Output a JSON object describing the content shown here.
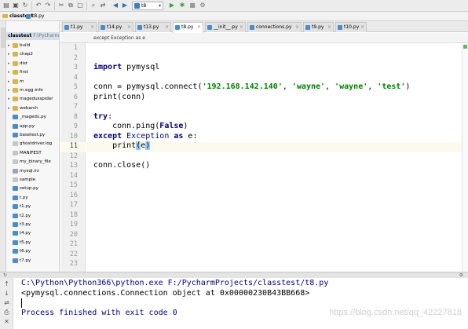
{
  "toolbar": {
    "run_config": "t8",
    "icons": [
      "folder-open-icon",
      "save-icon",
      "sync-icon",
      "undo-icon",
      "redo-icon",
      "cut-icon",
      "copy-icon",
      "paste-icon",
      "find-icon",
      "replace-icon",
      "back-icon",
      "forward-icon",
      "run-icon",
      "debug-icon",
      "stop-icon",
      "build-icon"
    ]
  },
  "breadcrumb": {
    "project": "classtest",
    "file": "t8.py"
  },
  "project_tree": {
    "root_name": "classtest",
    "root_path": "F:\\Pycharm",
    "items": [
      {
        "label": "build",
        "kind": "folder"
      },
      {
        "label": "chap2",
        "kind": "folder"
      },
      {
        "label": "dist",
        "kind": "folder"
      },
      {
        "label": "first",
        "kind": "folder"
      },
      {
        "label": "m",
        "kind": "folder"
      },
      {
        "label": "m.egg-info",
        "kind": "folder"
      },
      {
        "label": "magedusspider",
        "kind": "folder"
      },
      {
        "label": "webarch",
        "kind": "folder"
      },
      {
        "label": "_magedu.py",
        "kind": "py"
      },
      {
        "label": "app.py",
        "kind": "py"
      },
      {
        "label": "basetest.py",
        "kind": "py"
      },
      {
        "label": "ghostdriver.log",
        "kind": "file"
      },
      {
        "label": "MANIFEST",
        "kind": "file"
      },
      {
        "label": "my_binary_file",
        "kind": "file"
      },
      {
        "label": "mysql.ini",
        "kind": "cfg"
      },
      {
        "label": "sample",
        "kind": "file"
      },
      {
        "label": "setup.py",
        "kind": "py"
      },
      {
        "label": "t.py",
        "kind": "py"
      },
      {
        "label": "t1.py",
        "kind": "py"
      },
      {
        "label": "t2.py",
        "kind": "py"
      },
      {
        "label": "t3.py",
        "kind": "py"
      },
      {
        "label": "t4.py",
        "kind": "py"
      },
      {
        "label": "t5.py",
        "kind": "py"
      },
      {
        "label": "t6.py",
        "kind": "py"
      },
      {
        "label": "t7.py",
        "kind": "py"
      }
    ]
  },
  "tabs": [
    {
      "label": "t1.py",
      "active": false
    },
    {
      "label": "t14.py",
      "active": false
    },
    {
      "label": "t13.py",
      "active": false
    },
    {
      "label": "t8.py",
      "active": true
    },
    {
      "label": "__init__.py",
      "active": false
    },
    {
      "label": "connections.py",
      "active": false
    },
    {
      "label": "t9.py",
      "active": false
    },
    {
      "label": "t10.py",
      "active": false
    }
  ],
  "scope_breadcrumb": "except Exception as e",
  "editor": {
    "line_numbers": [
      "1",
      "2",
      "3",
      "4",
      "5",
      "6",
      "7",
      "8",
      "9",
      "10",
      "11",
      "12",
      "13",
      "14",
      "15",
      "16",
      "17",
      "18",
      "19",
      "20",
      "21",
      "22",
      "23"
    ],
    "current_line": "11"
  },
  "code": {
    "l2_import": "import",
    "l2_module": " pymysql",
    "l4_pre": "conn = pymysql.connect(",
    "l4_s1": "'192.168.142.140'",
    "l4_c1": ", ",
    "l4_s2": "'wayne'",
    "l4_c2": ", ",
    "l4_s3": "'wayne'",
    "l4_c3": ", ",
    "l4_s4": "'test'",
    "l4_end": ")",
    "l5": "print(conn)",
    "l7_try": "try",
    "l7_colon": ":",
    "l8_pre": "    conn.ping(",
    "l8_false": "False",
    "l8_end": ")",
    "l9_except": "except",
    "l9_space": " ",
    "l9_exc": "Exception",
    "l9_as": " as",
    "l9_end": " e:",
    "l10_pre": "    print",
    "l10_open": "(",
    "l10_var": "e",
    "l10_close": ")",
    "l12": "conn.close()"
  },
  "console": {
    "line1": "C:\\Python\\Python366\\python.exe F:/PycharmProjects/classtest/t8.py",
    "line2": "<pymysql.connections.Connection object at 0x00000230B43BB668>",
    "line3": "Process finished with exit code 0"
  },
  "watermark": "https://blog.csdn.net/qq_42227818",
  "colors": {
    "keyword": "#000080",
    "string": "#008000",
    "current_line": "#fcfaed",
    "console_text": "#000080"
  }
}
